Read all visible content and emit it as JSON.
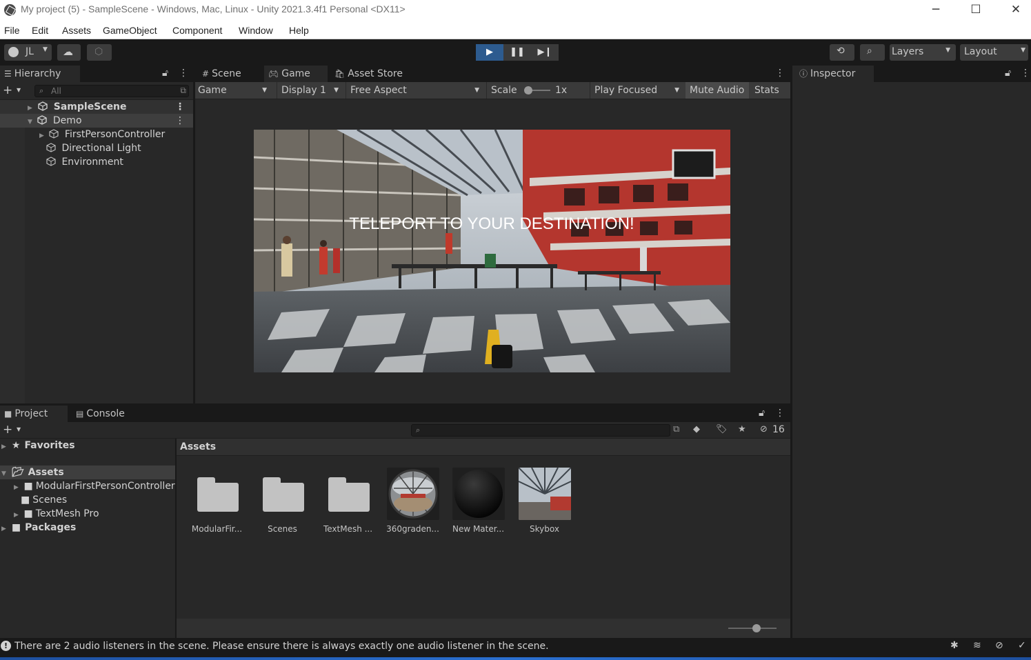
{
  "window": {
    "title": "My project (5) - SampleScene - Windows, Mac, Linux - Unity 2021.3.4f1 Personal <DX11>",
    "minimize": "─",
    "maximize": "☐",
    "close": "✕"
  },
  "menu": [
    "File",
    "Edit",
    "Assets",
    "GameObject",
    "Component",
    "Window",
    "Help"
  ],
  "toolbar": {
    "account": "JL",
    "layers": "Layers",
    "layout": "Layout"
  },
  "hierarchy": {
    "tab": "Hierarchy",
    "search_placeholder": "All",
    "items": [
      {
        "label": "SampleScene"
      },
      {
        "label": "Demo"
      },
      {
        "label": "FirstPersonController"
      },
      {
        "label": "Directional Light"
      },
      {
        "label": "Environment"
      }
    ]
  },
  "center_tabs": [
    {
      "label": "Scene"
    },
    {
      "label": "Game"
    },
    {
      "label": "Asset Store"
    }
  ],
  "game_toolbar": {
    "mode": "Game",
    "display": "Display 1",
    "aspect": "Free Aspect",
    "scale_label": "Scale",
    "scale_value": "1x",
    "play_focused": "Play Focused",
    "mute_audio": "Mute Audio",
    "stats": "Stats"
  },
  "game_view": {
    "overlay_text": "TELEPORT TO YOUR DESTINATION!"
  },
  "inspector": {
    "tab": "Inspector"
  },
  "bottom_tabs": [
    {
      "label": "Project"
    },
    {
      "label": "Console"
    }
  ],
  "project": {
    "hidden_count": "16",
    "tree": [
      {
        "label": "Favorites"
      },
      {
        "label": "Assets"
      },
      {
        "label": "ModularFirstPersonController"
      },
      {
        "label": "Scenes"
      },
      {
        "label": "TextMesh Pro"
      },
      {
        "label": "Packages"
      }
    ],
    "breadcrumb": "Assets",
    "assets": [
      {
        "label": "ModularFir...",
        "kind": "folder"
      },
      {
        "label": "Scenes",
        "kind": "folder"
      },
      {
        "label": "TextMesh ...",
        "kind": "folder"
      },
      {
        "label": "360graden...",
        "kind": "panorama"
      },
      {
        "label": "New Mater...",
        "kind": "material"
      },
      {
        "label": "Skybox",
        "kind": "skybox"
      }
    ]
  },
  "status": {
    "message": "There are 2 audio listeners in the scene. Please ensure there is always exactly one audio listener in the scene."
  }
}
